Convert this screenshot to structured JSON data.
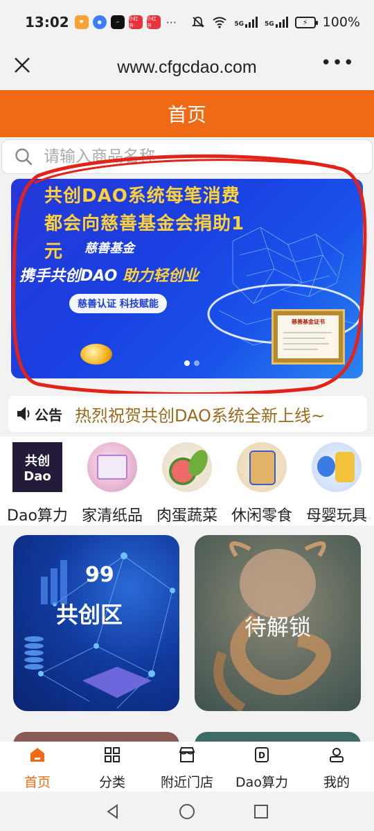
{
  "status_bar": {
    "time": "13:02",
    "battery": "100%",
    "net1": "5G",
    "net2": "5G",
    "app_badges": [
      "小红书",
      "小红书"
    ],
    "more": "···"
  },
  "browser": {
    "url": "www.cfgcdao.com",
    "more_label": "•••"
  },
  "header": {
    "title": "首页",
    "color": "#f06a15"
  },
  "search": {
    "placeholder": "请输入商品名称"
  },
  "banner": {
    "line1": "共创DAO系统每笔消费",
    "line2": "都会向慈善基金会捐助1",
    "line3": "元",
    "tag": "慈善基金",
    "slogan_a": "携手共创DAO",
    "slogan_b": "助力轻创业",
    "pill": "慈善认证 科技赋能",
    "certificate_title": "慈善基金证书",
    "slides": 2,
    "active_slide": 1
  },
  "notice": {
    "label": "公告",
    "text": "热烈祝贺共创DAO系统全新上线~"
  },
  "categories": [
    {
      "label": "Dao算力",
      "icon_text_1": "共创",
      "icon_text_2": "Dao"
    },
    {
      "label": "家清纸品"
    },
    {
      "label": "肉蛋蔬菜"
    },
    {
      "label": "休闲零食"
    },
    {
      "label": "母婴玩具"
    }
  ],
  "tiles": [
    {
      "number": "99",
      "title": "共创区"
    },
    {
      "title": "待解锁"
    }
  ],
  "bottom_nav": [
    {
      "label": "首页",
      "active": true
    },
    {
      "label": "分类"
    },
    {
      "label": "附近门店"
    },
    {
      "label": "Dao算力"
    },
    {
      "label": "我的"
    }
  ],
  "colors": {
    "accent": "#f06a15",
    "notice_text": "#9a6a1c"
  }
}
